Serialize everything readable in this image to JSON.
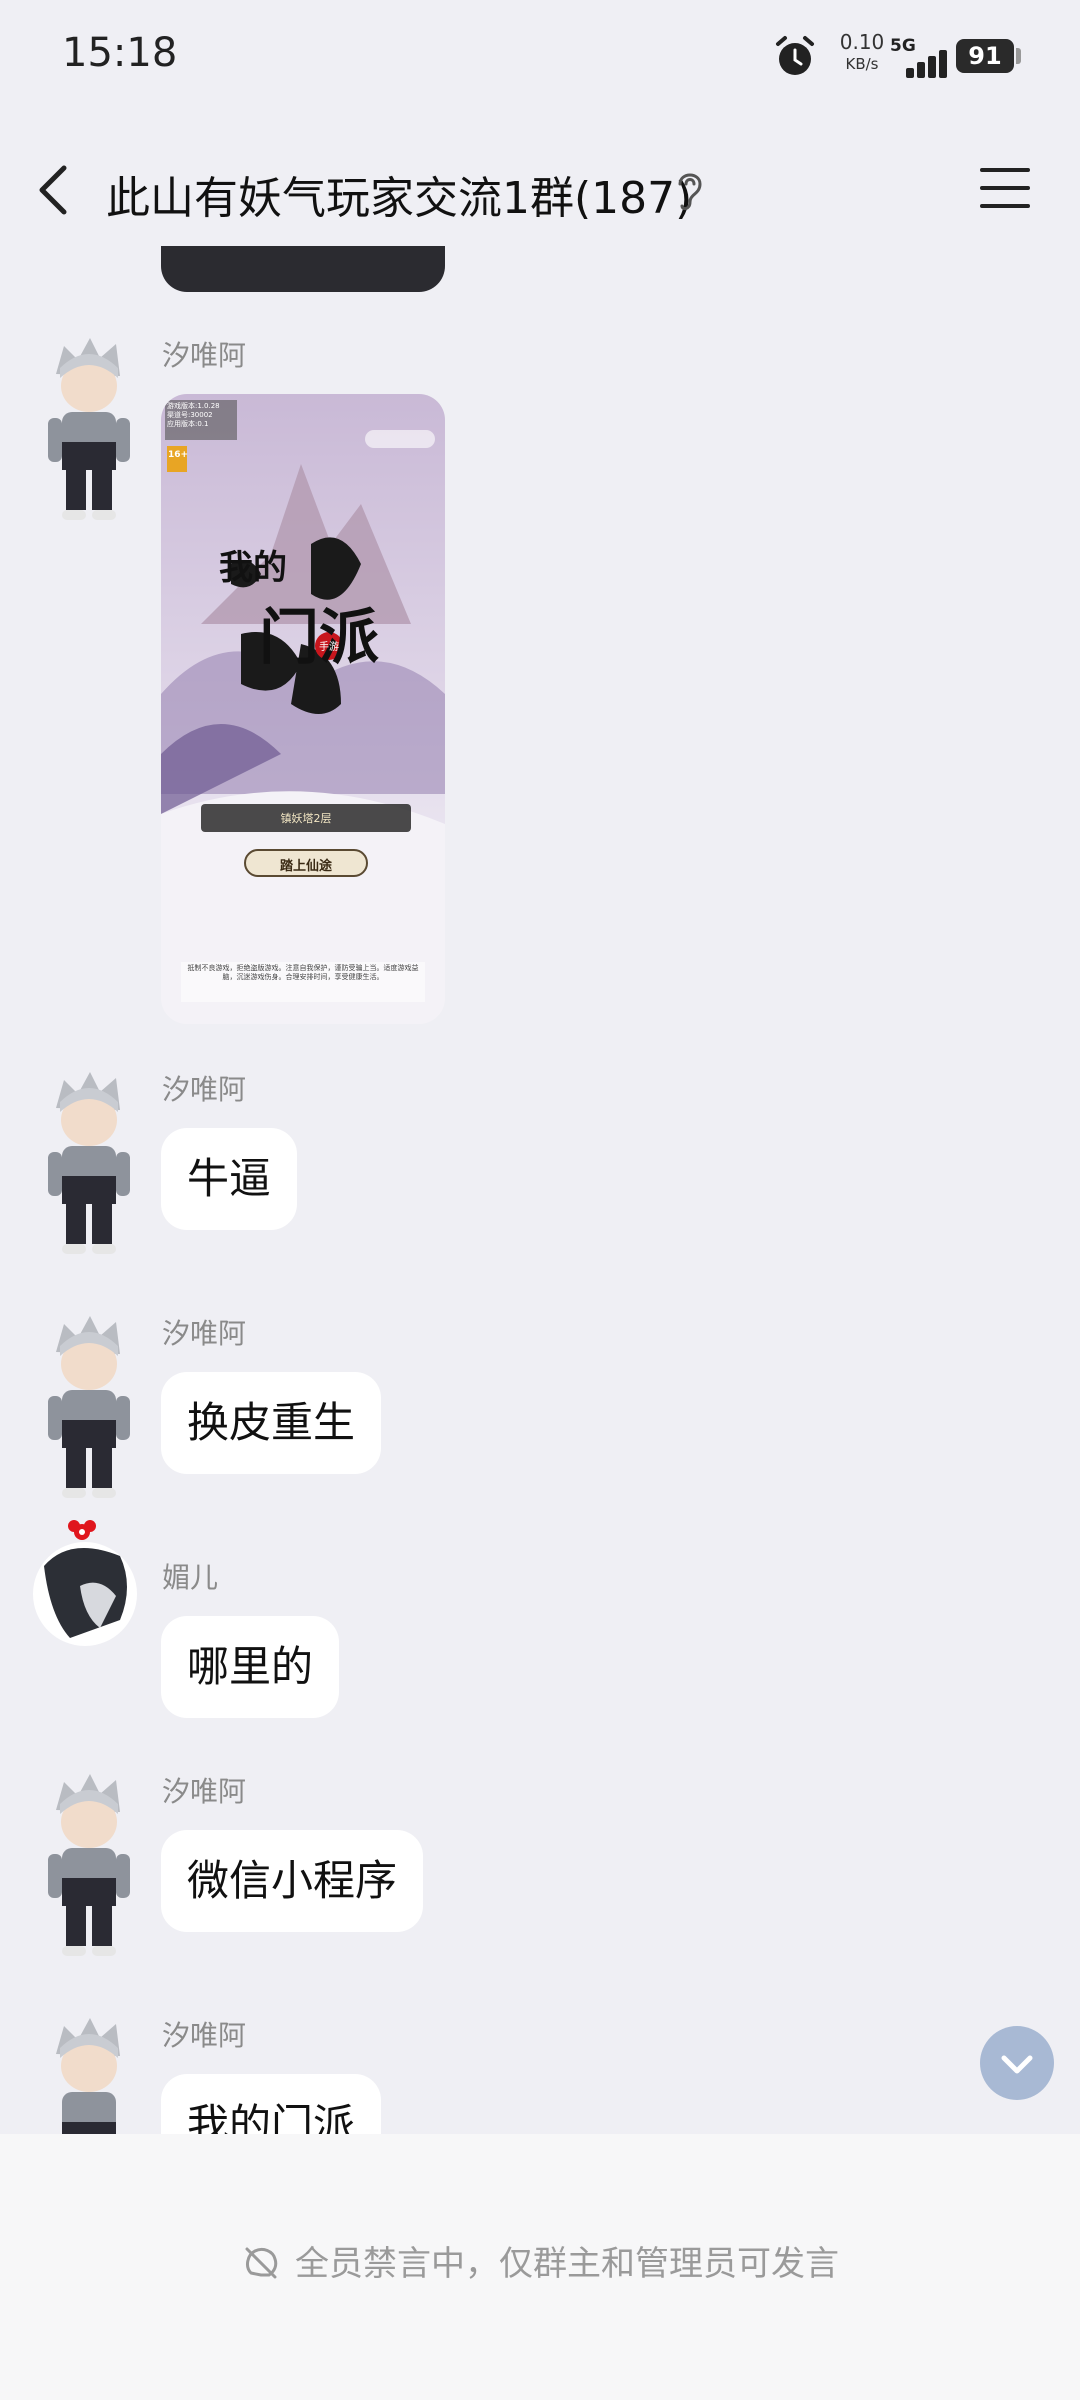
{
  "status_bar": {
    "time": "15:18",
    "net_speed": "0.10",
    "net_unit": "KB/s",
    "network": "5G",
    "battery": "91"
  },
  "header": {
    "title": "此山有妖气玩家交流1群(187)"
  },
  "messages": [
    {
      "sender": "汐唯阿",
      "type": "image",
      "image": {
        "info_lines": [
          "游戏版本:1.0.28",
          "渠道号:30002",
          "应用版本:0.1"
        ],
        "age_badge": "16+",
        "game_title": [
          "我的",
          "门派"
        ],
        "seal": "手游",
        "level_text": "镇妖塔2层",
        "start_button": "踏上仙途",
        "notice": "抵制不良游戏，拒绝盗版游戏。注意自我保护，谨防受骗上当。适度游戏益脑，沉迷游戏伤身。合理安排时间，享受健康生活。"
      }
    },
    {
      "sender": "汐唯阿",
      "text": "牛逼"
    },
    {
      "sender": "汐唯阿",
      "text": "换皮重生"
    },
    {
      "sender": "媚儿",
      "text": "哪里的"
    },
    {
      "sender": "汐唯阿",
      "text": "微信小程序"
    },
    {
      "sender": "汐唯阿",
      "text": "我的门派"
    }
  ],
  "footer": {
    "mute_notice": "全员禁言中，仅群主和管理员可发言"
  },
  "colors": {
    "background": "#efeff4",
    "bubble": "#ffffff",
    "scroll_button": "#a8b9d4"
  }
}
